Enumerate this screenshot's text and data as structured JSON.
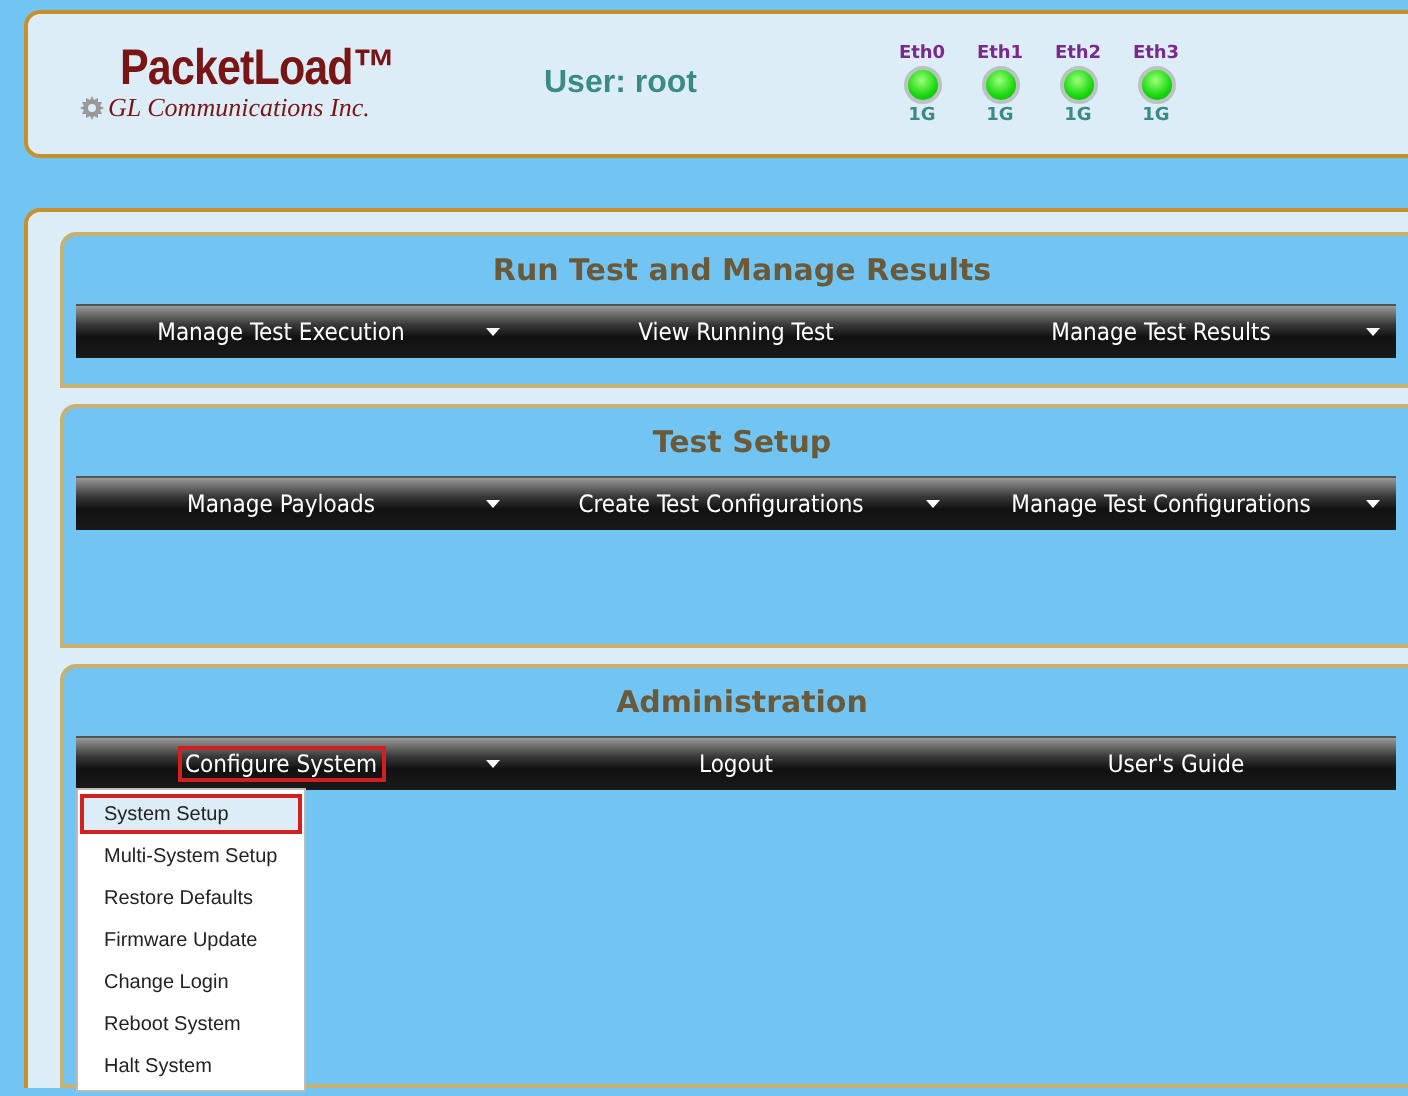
{
  "header": {
    "logo": "PacketLoad™",
    "company": "GL Communications Inc.",
    "user": "User: root",
    "ports": [
      {
        "name": "Eth0",
        "on": true,
        "speed": "1G"
      },
      {
        "name": "Eth1",
        "on": true,
        "speed": "1G"
      },
      {
        "name": "Eth2",
        "on": true,
        "speed": "1G"
      },
      {
        "name": "Eth3",
        "on": true,
        "speed": "1G"
      }
    ]
  },
  "sections": [
    {
      "title": "Run Test and Manage Results",
      "menu": [
        {
          "label": "Manage Test Execution",
          "dropdown": true,
          "highlighted": false
        },
        {
          "label": "View Running Test",
          "dropdown": false,
          "highlighted": false
        },
        {
          "label": "Manage Test Results",
          "dropdown": true,
          "highlighted": false
        }
      ]
    },
    {
      "title": "Test Setup",
      "menu": [
        {
          "label": "Manage Payloads",
          "dropdown": true,
          "highlighted": false
        },
        {
          "label": "Create Test Configurations",
          "dropdown": true,
          "highlighted": false
        },
        {
          "label": "Manage Test Configurations",
          "dropdown": true,
          "highlighted": false
        }
      ]
    },
    {
      "title": "Administration",
      "menu": [
        {
          "label": "Configure System",
          "dropdown": true,
          "highlighted": true,
          "submenu": [
            {
              "label": "System Setup",
              "selected": true
            },
            {
              "label": "Multi-System Setup",
              "selected": false
            },
            {
              "label": "Restore Defaults",
              "selected": false
            },
            {
              "label": "Firmware Update",
              "selected": false
            },
            {
              "label": "Change Login",
              "selected": false
            },
            {
              "label": "Reboot System",
              "selected": false
            },
            {
              "label": "Halt System",
              "selected": false
            }
          ]
        },
        {
          "label": "Logout",
          "dropdown": false,
          "highlighted": false
        },
        {
          "label": "User's Guide",
          "dropdown": false,
          "highlighted": false
        }
      ]
    }
  ]
}
